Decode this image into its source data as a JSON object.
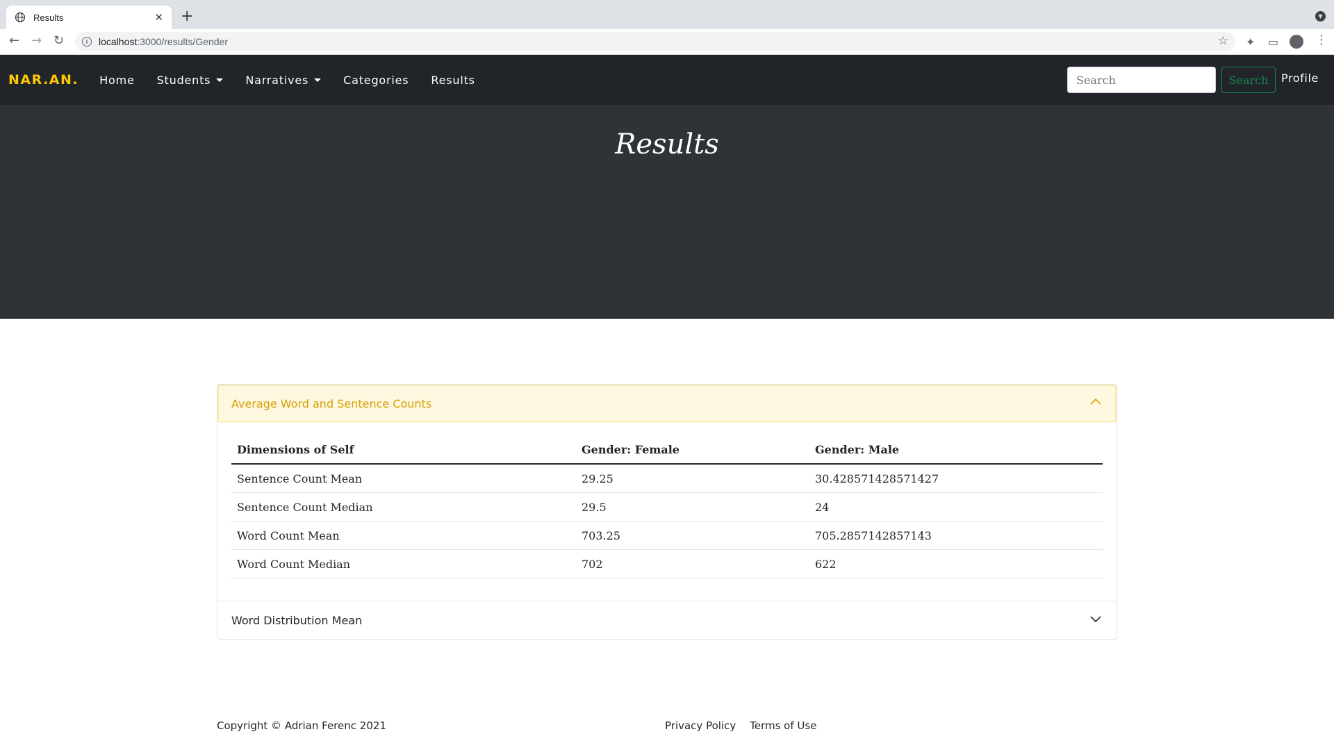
{
  "browser": {
    "tab_title": "Results",
    "tab_close": "✕",
    "new_tab": "+",
    "url_host": "localhost",
    "url_path": ":3000/results/Gender",
    "back": "←",
    "forward": "→",
    "reload": "↻",
    "star": "☆",
    "extensions": "✦",
    "cast": "▭",
    "menu": "⋮"
  },
  "navbar": {
    "brand": "NAR.AN.",
    "links": [
      "Home",
      "Students",
      "Narratives",
      "Categories",
      "Results"
    ],
    "search_placeholder": "Search",
    "search_button": "Search",
    "profile": "Profile"
  },
  "header": {
    "title": "Results"
  },
  "accordion": {
    "section1": {
      "title": "Average Word and Sentence Counts",
      "columns": [
        "Dimensions of Self",
        "Gender: Female",
        "Gender: Male"
      ],
      "rows": [
        [
          "Sentence Count Mean",
          "29.25",
          "30.428571428571427"
        ],
        [
          "Sentence Count Median",
          "29.5",
          "24"
        ],
        [
          "Word Count Mean",
          "703.25",
          "705.2857142857143"
        ],
        [
          "Word Count Median",
          "702",
          "622"
        ]
      ]
    },
    "section2": {
      "title": "Word Distribution Mean"
    }
  },
  "footer": {
    "copyright": "Copyright © Adrian Ferenc 2021",
    "privacy": "Privacy Policy",
    "terms": "Terms of Use"
  },
  "colors": {
    "brand": "#ffc800",
    "navbar_bg": "#212529",
    "masthead_bg": "#2e3338",
    "accordion_active_bg": "#fff8e1",
    "accordion_active_text": "#d4a106",
    "search_button": "#198754"
  }
}
